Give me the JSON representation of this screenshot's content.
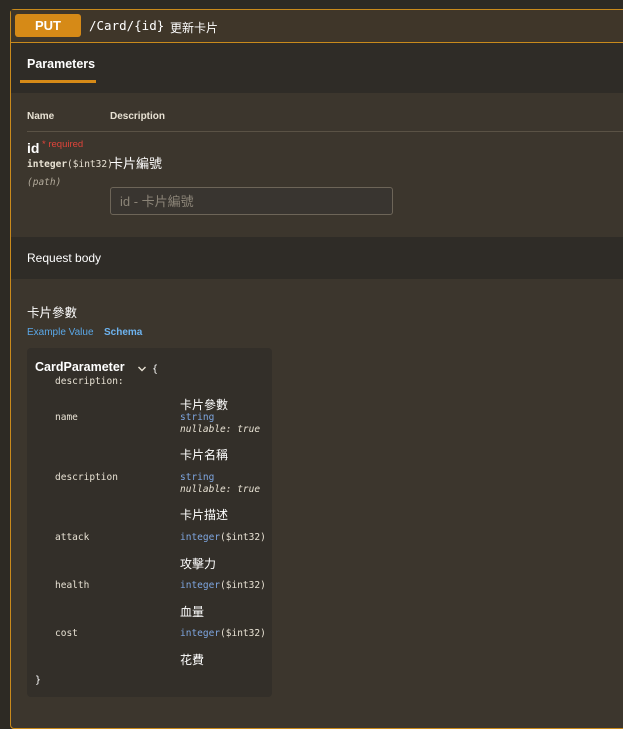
{
  "endpoint": {
    "method": "PUT",
    "path": "/Card/{id}",
    "summary": "更新卡片",
    "accent_color": "#d68a17"
  },
  "parameters": {
    "tab_label": "Parameters",
    "col_name": "Name",
    "col_description": "Description",
    "items": [
      {
        "name": "id",
        "required_label": "* required",
        "type": "integer",
        "format": "($int32)",
        "in": "(path)",
        "description": "卡片編號",
        "placeholder": "id - 卡片編號"
      }
    ]
  },
  "request_body": {
    "title": "Request body",
    "description": "卡片參數",
    "tabs": [
      "Example Value",
      "Schema"
    ],
    "active_tab": "Schema",
    "model": {
      "name": "CardParameter",
      "brace_open": "{",
      "brace_close": "}",
      "properties": [
        {
          "key": "description:",
          "type": "",
          "format": "",
          "nullable": "",
          "desc": "卡片參數"
        },
        {
          "key": "name",
          "type": "string",
          "format": "",
          "nullable": "nullable: true",
          "desc": "卡片名稱"
        },
        {
          "key": "description",
          "type": "string",
          "format": "",
          "nullable": "nullable: true",
          "desc": "卡片描述"
        },
        {
          "key": "attack",
          "type": "integer",
          "format": "($int32)",
          "nullable": "",
          "desc": "攻擊力"
        },
        {
          "key": "health",
          "type": "integer",
          "format": "($int32)",
          "nullable": "",
          "desc": "血量"
        },
        {
          "key": "cost",
          "type": "integer",
          "format": "($int32)",
          "nullable": "",
          "desc": "花費"
        }
      ]
    }
  }
}
